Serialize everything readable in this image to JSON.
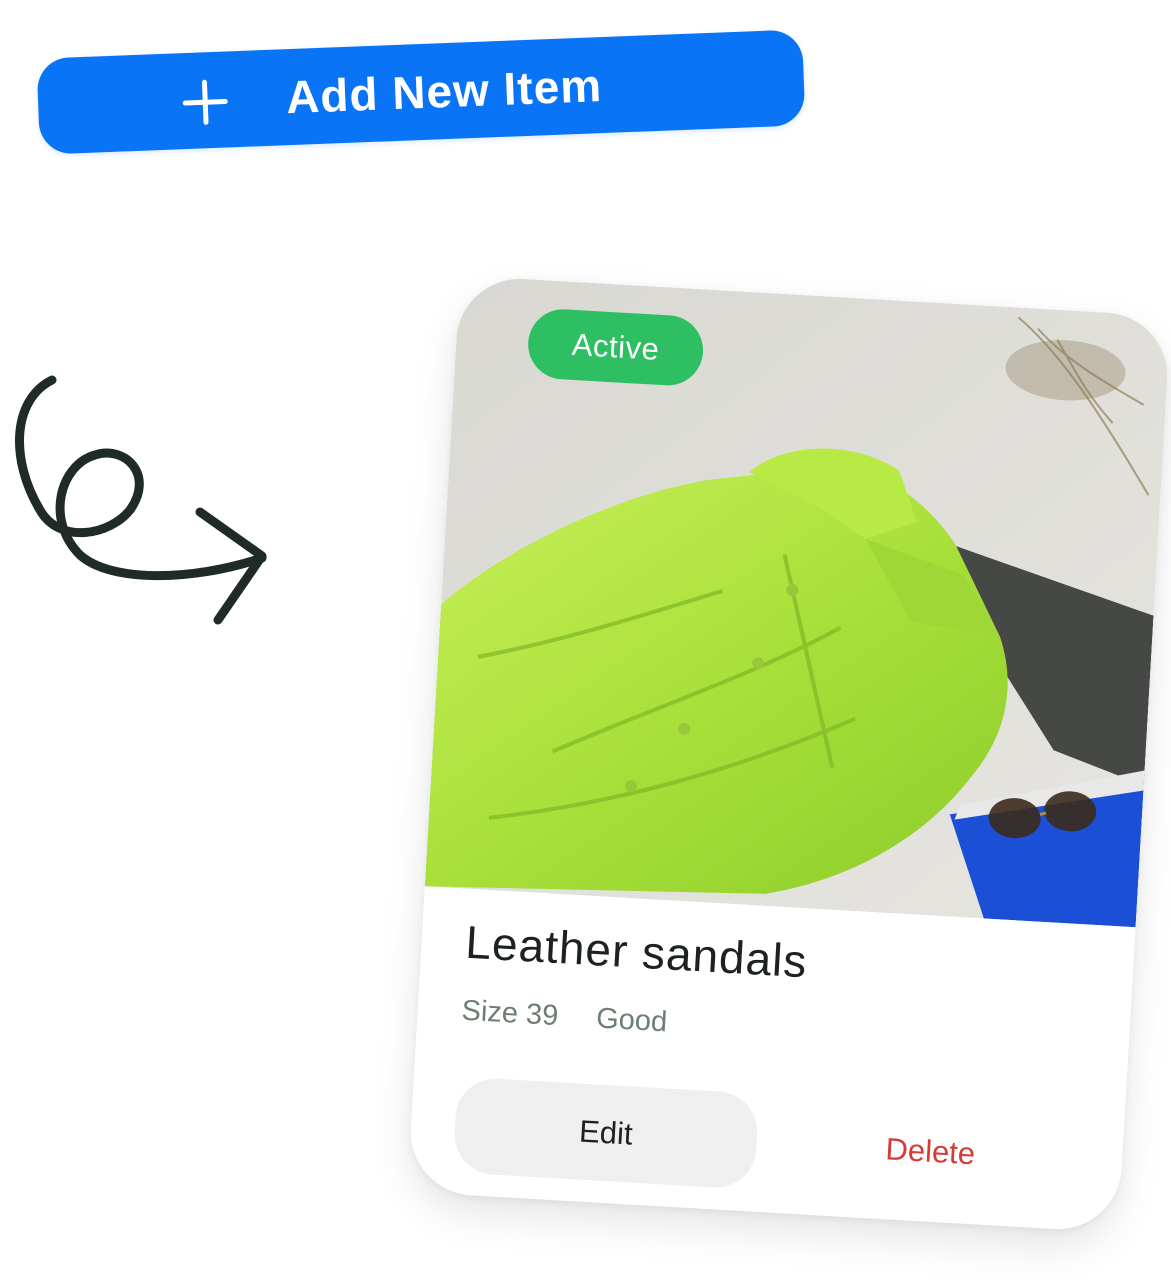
{
  "add_button": {
    "label": "Add New Item",
    "icon": "plus-icon"
  },
  "decoration": {
    "icon": "swirl-arrow-icon"
  },
  "card": {
    "status": "Active",
    "title": "Leather sandals",
    "size": "Size 39",
    "condition": "Good",
    "edit_label": "Edit",
    "delete_label": "Delete",
    "image": "green-shirt-photo"
  },
  "colors": {
    "accent": "#0a74f7",
    "status_active": "#2dbf62",
    "danger": "#d83a36",
    "meta_text": "#6c7f72"
  }
}
